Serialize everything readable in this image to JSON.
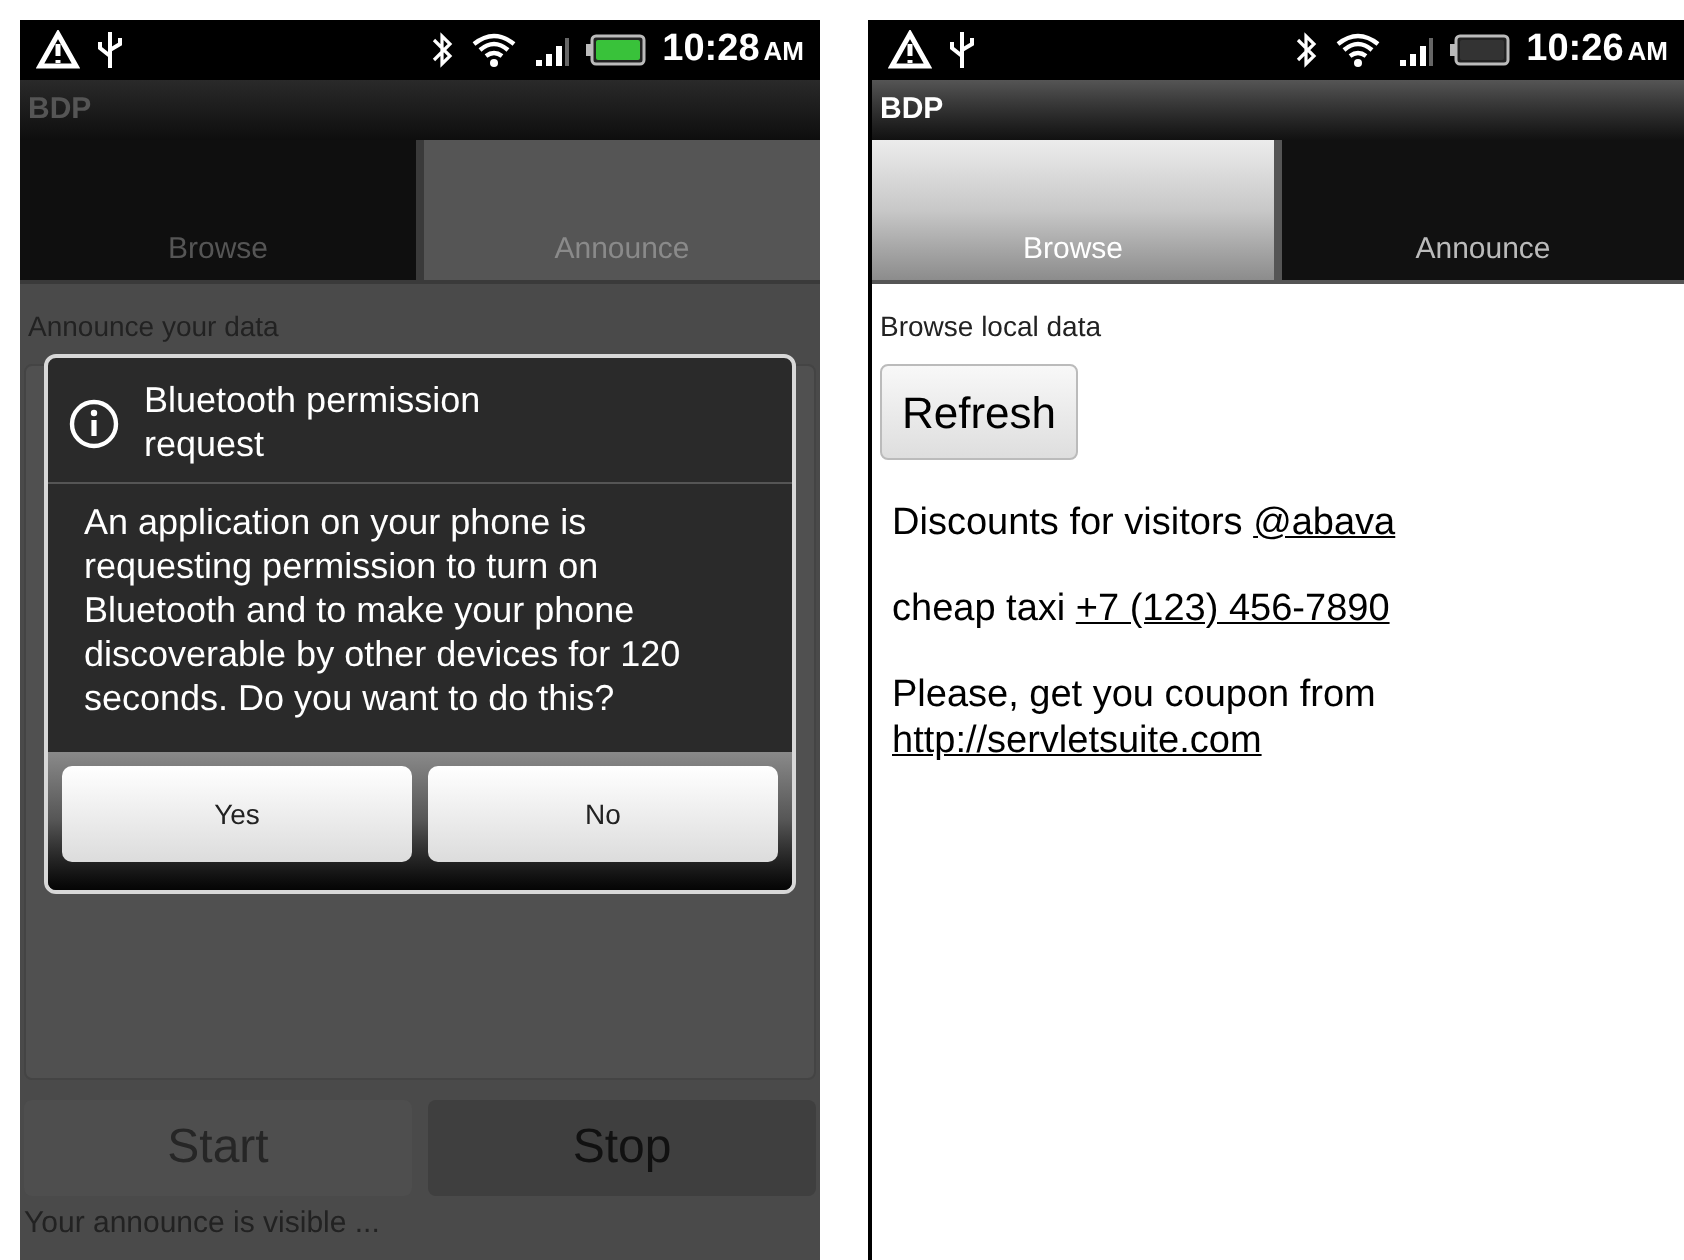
{
  "screens": [
    {
      "kind": "announce",
      "status": {
        "time": "10:28",
        "ampm": "AM",
        "battery_charging": true
      },
      "app_title": "BDP",
      "dimmed": true,
      "tabs": [
        {
          "label": "Browse",
          "selected": false
        },
        {
          "label": "Announce",
          "selected": true
        }
      ],
      "subtitle": "Announce your data",
      "buttons": [
        {
          "label": "Start",
          "disabled": true
        },
        {
          "label": "Stop",
          "disabled": false
        }
      ],
      "footer": "Your announce is visible ...",
      "dialog": {
        "title": "Bluetooth permission request",
        "message": "An application on your phone is requesting permission to turn on Bluetooth and to make your phone discoverable by other devices for 120 seconds. Do you want to do this?",
        "buttons": [
          "Yes",
          "No"
        ]
      }
    },
    {
      "kind": "browse",
      "status": {
        "time": "10:26",
        "ampm": "AM",
        "battery_charging": false
      },
      "app_title": "BDP",
      "dimmed": false,
      "tabs": [
        {
          "label": "Browse",
          "selected": true
        },
        {
          "label": "Announce",
          "selected": false
        }
      ],
      "subtitle": "Browse local data",
      "refresh": "Refresh",
      "items": [
        {
          "text": "Discounts for visitors",
          "link": "@abava"
        },
        {
          "text": "cheap taxi",
          "link": "+7 (123) 456-7890"
        },
        {
          "text": "Please, get you coupon from",
          "link": "http://servletsuite.com"
        }
      ]
    }
  ]
}
